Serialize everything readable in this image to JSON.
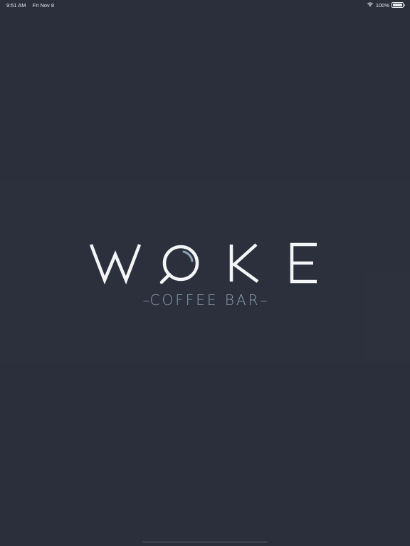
{
  "status_bar": {
    "time": "9:51 AM",
    "date": "Fri Nov 8",
    "battery": "100%",
    "battery_level": 1.0,
    "wifi_icon": "wifi-icon",
    "battery_icon": "battery-icon"
  },
  "logo": {
    "brand": "WOKE",
    "tagline": "COFFEE BAR",
    "text_color": "#f4f5f7",
    "accent_color": "#8c9fb0"
  },
  "colors": {
    "background": "#2a2f3b"
  }
}
